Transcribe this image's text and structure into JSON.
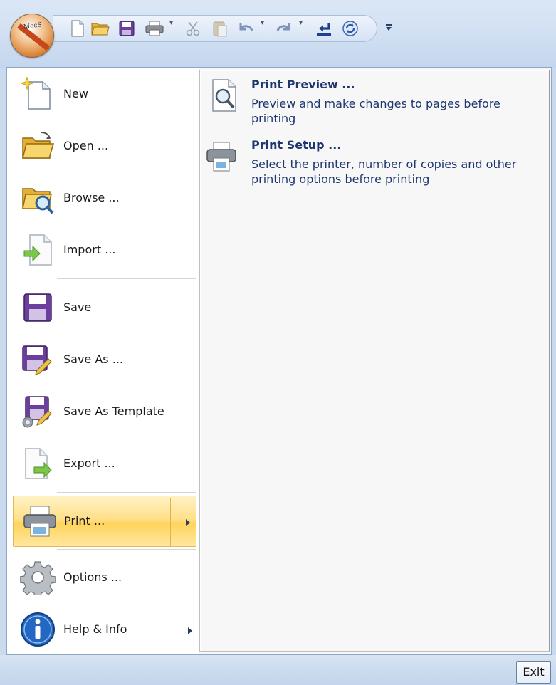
{
  "app": {
    "logo_text": "MecS"
  },
  "qat": {
    "buttons": [
      "new-file",
      "open-folder",
      "save-disk",
      "print",
      "cut",
      "paste",
      "undo",
      "redo",
      "repeat",
      "refresh"
    ]
  },
  "menu": {
    "items": [
      {
        "label": "New",
        "icon": "new-file-icon"
      },
      {
        "label": "Open ...",
        "icon": "open-folder-icon"
      },
      {
        "label": "Browse ...",
        "icon": "browse-folder-icon"
      },
      {
        "label": "Import ...",
        "icon": "import-icon"
      },
      {
        "label": "Save",
        "icon": "save-icon"
      },
      {
        "label": "Save As ...",
        "icon": "save-as-icon"
      },
      {
        "label": "Save As Template",
        "icon": "save-as-template-icon"
      },
      {
        "label": "Export ...",
        "icon": "export-icon"
      },
      {
        "label": "Print ...",
        "icon": "printer-icon",
        "selected": true,
        "has_submenu": true
      },
      {
        "label": "Options ...",
        "icon": "gear-icon"
      },
      {
        "label": "Help & Info",
        "icon": "info-icon",
        "has_submenu": true
      }
    ]
  },
  "submenu": {
    "items": [
      {
        "title": "Print Preview ...",
        "description": "Preview and make changes to pages before printing",
        "icon": "print-preview-icon"
      },
      {
        "title": "Print Setup ...",
        "description": "Select the printer, number of copies and other printing options before printing",
        "icon": "printer-icon"
      }
    ]
  },
  "footer": {
    "exit_label": "Exit"
  },
  "colors": {
    "selected_highlight": "#ffd45c",
    "submenu_text": "#1d3670",
    "panel_border": "#8fa6c7"
  }
}
